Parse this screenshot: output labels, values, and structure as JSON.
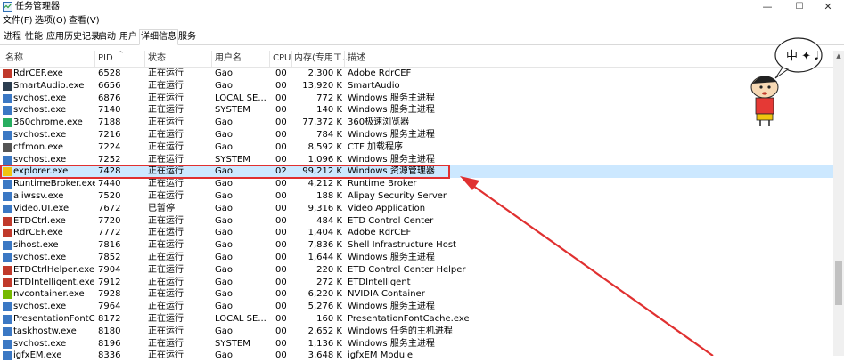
{
  "window": {
    "title": "任务管理器",
    "min": "—",
    "max": "☐",
    "close": "✕"
  },
  "menu": [
    "文件(F)",
    "选项(O)",
    "查看(V)"
  ],
  "tabs": [
    "进程",
    "性能",
    "应用历史记录",
    "启动",
    "用户",
    "详细信息",
    "服务"
  ],
  "active_tab": 5,
  "columns": {
    "name": "名称",
    "pid": "PID",
    "status": "状态",
    "user": "用户名",
    "cpu": "CPU",
    "mem": "内存(专用工...",
    "desc": "描述"
  },
  "sticker_text": "中 ✦ 𝅘𝅥",
  "rows": [
    {
      "name": "RdrCEF.exe",
      "pid": "6528",
      "status": "正在运行",
      "user": "Gao",
      "cpu": "00",
      "mem": "2,300 K",
      "desc": "Adobe RdrCEF",
      "icon": "#c0392b"
    },
    {
      "name": "SmartAudio.exe",
      "pid": "6656",
      "status": "正在运行",
      "user": "Gao",
      "cpu": "00",
      "mem": "13,920 K",
      "desc": "SmartAudio",
      "icon": "#2c3e50"
    },
    {
      "name": "svchost.exe",
      "pid": "6876",
      "status": "正在运行",
      "user": "LOCAL SE...",
      "cpu": "00",
      "mem": "772 K",
      "desc": "Windows 服务主进程",
      "icon": "#3b78c4"
    },
    {
      "name": "svchost.exe",
      "pid": "7140",
      "status": "正在运行",
      "user": "SYSTEM",
      "cpu": "00",
      "mem": "140 K",
      "desc": "Windows 服务主进程",
      "icon": "#3b78c4"
    },
    {
      "name": "360chrome.exe",
      "pid": "7188",
      "status": "正在运行",
      "user": "Gao",
      "cpu": "00",
      "mem": "77,372 K",
      "desc": "360极速浏览器",
      "icon": "#27ae60"
    },
    {
      "name": "svchost.exe",
      "pid": "7216",
      "status": "正在运行",
      "user": "Gao",
      "cpu": "00",
      "mem": "784 K",
      "desc": "Windows 服务主进程",
      "icon": "#3b78c4"
    },
    {
      "name": "ctfmon.exe",
      "pid": "7224",
      "status": "正在运行",
      "user": "Gao",
      "cpu": "00",
      "mem": "8,592 K",
      "desc": "CTF 加载程序",
      "icon": "#555555"
    },
    {
      "name": "svchost.exe",
      "pid": "7252",
      "status": "正在运行",
      "user": "SYSTEM",
      "cpu": "00",
      "mem": "1,096 K",
      "desc": "Windows 服务主进程",
      "icon": "#3b78c4"
    },
    {
      "name": "explorer.exe",
      "pid": "7428",
      "status": "正在运行",
      "user": "Gao",
      "cpu": "02",
      "mem": "99,212 K",
      "desc": "Windows 资源管理器",
      "icon": "#f1c40f"
    },
    {
      "name": "RuntimeBroker.exe",
      "pid": "7440",
      "status": "正在运行",
      "user": "Gao",
      "cpu": "00",
      "mem": "4,212 K",
      "desc": "Runtime Broker",
      "icon": "#3b78c4"
    },
    {
      "name": "aliwssv.exe",
      "pid": "7520",
      "status": "正在运行",
      "user": "Gao",
      "cpu": "00",
      "mem": "188 K",
      "desc": "Alipay Security Server",
      "icon": "#3b78c4"
    },
    {
      "name": "Video.UI.exe",
      "pid": "7672",
      "status": "已暂停",
      "user": "Gao",
      "cpu": "00",
      "mem": "9,316 K",
      "desc": "Video Application",
      "icon": "#3b78c4"
    },
    {
      "name": "ETDCtrl.exe",
      "pid": "7720",
      "status": "正在运行",
      "user": "Gao",
      "cpu": "00",
      "mem": "484 K",
      "desc": "ETD Control Center",
      "icon": "#c0392b"
    },
    {
      "name": "RdrCEF.exe",
      "pid": "7772",
      "status": "正在运行",
      "user": "Gao",
      "cpu": "00",
      "mem": "1,404 K",
      "desc": "Adobe RdrCEF",
      "icon": "#c0392b"
    },
    {
      "name": "sihost.exe",
      "pid": "7816",
      "status": "正在运行",
      "user": "Gao",
      "cpu": "00",
      "mem": "7,836 K",
      "desc": "Shell Infrastructure Host",
      "icon": "#3b78c4"
    },
    {
      "name": "svchost.exe",
      "pid": "7852",
      "status": "正在运行",
      "user": "Gao",
      "cpu": "00",
      "mem": "1,644 K",
      "desc": "Windows 服务主进程",
      "icon": "#3b78c4"
    },
    {
      "name": "ETDCtrlHelper.exe",
      "pid": "7904",
      "status": "正在运行",
      "user": "Gao",
      "cpu": "00",
      "mem": "220 K",
      "desc": "ETD Control Center Helper",
      "icon": "#c0392b"
    },
    {
      "name": "ETDIntelligent.exe",
      "pid": "7912",
      "status": "正在运行",
      "user": "Gao",
      "cpu": "00",
      "mem": "272 K",
      "desc": "ETDIntelligent",
      "icon": "#c0392b"
    },
    {
      "name": "nvcontainer.exe",
      "pid": "7928",
      "status": "正在运行",
      "user": "Gao",
      "cpu": "00",
      "mem": "6,220 K",
      "desc": "NVIDIA Container",
      "icon": "#76b900"
    },
    {
      "name": "svchost.exe",
      "pid": "7964",
      "status": "正在运行",
      "user": "Gao",
      "cpu": "00",
      "mem": "5,276 K",
      "desc": "Windows 服务主进程",
      "icon": "#3b78c4"
    },
    {
      "name": "PresentationFontCa...",
      "pid": "8172",
      "status": "正在运行",
      "user": "LOCAL SE...",
      "cpu": "00",
      "mem": "160 K",
      "desc": "PresentationFontCache.exe",
      "icon": "#3b78c4"
    },
    {
      "name": "taskhostw.exe",
      "pid": "8180",
      "status": "正在运行",
      "user": "Gao",
      "cpu": "00",
      "mem": "2,652 K",
      "desc": "Windows 任务的主机进程",
      "icon": "#3b78c4"
    },
    {
      "name": "svchost.exe",
      "pid": "8196",
      "status": "正在运行",
      "user": "SYSTEM",
      "cpu": "00",
      "mem": "1,136 K",
      "desc": "Windows 服务主进程",
      "icon": "#3b78c4"
    },
    {
      "name": "igfxEM.exe",
      "pid": "8336",
      "status": "正在运行",
      "user": "Gao",
      "cpu": "00",
      "mem": "3,648 K",
      "desc": "igfxEM Module",
      "icon": "#3b78c4"
    }
  ],
  "selected_index": 8,
  "colors": {
    "selection": "#cce8ff",
    "annotation": "#e03030"
  }
}
